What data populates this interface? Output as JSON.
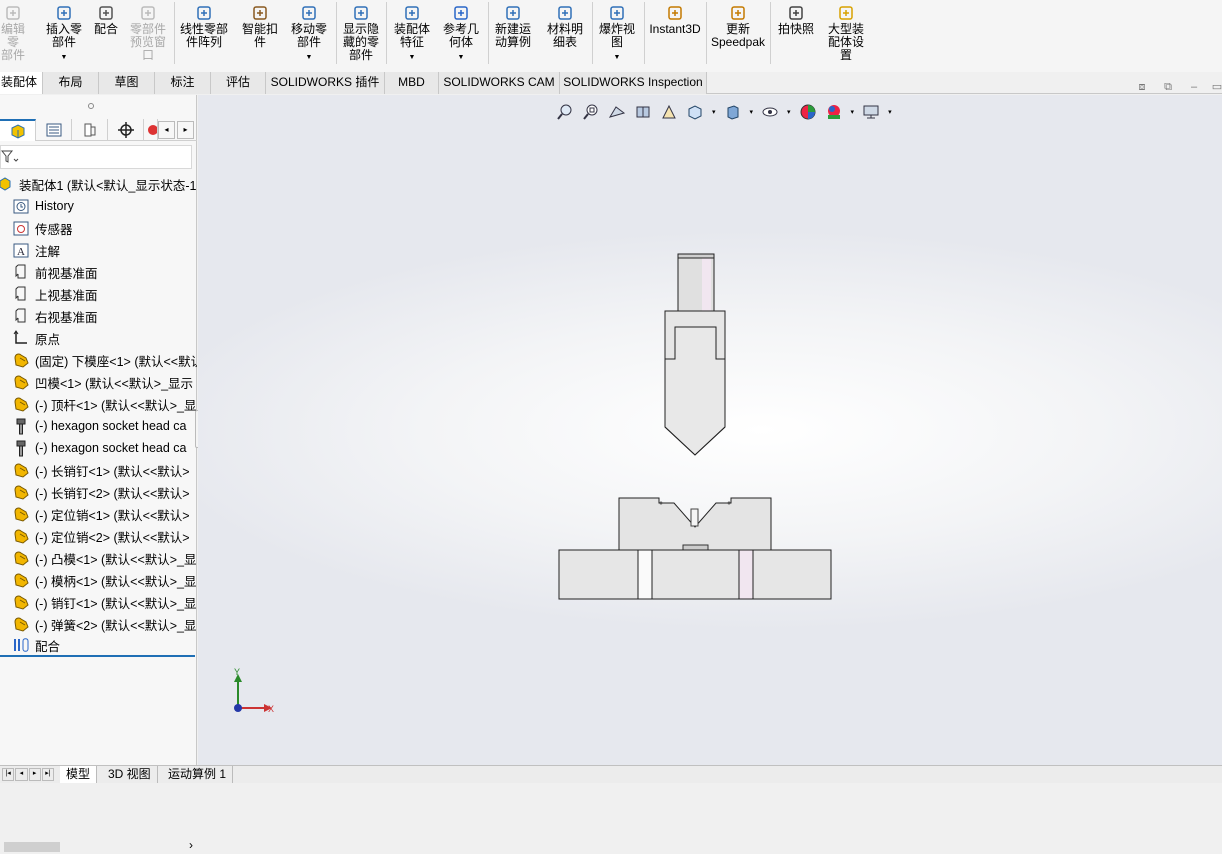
{
  "ribbon": {
    "buttons": [
      {
        "label": "编辑零\n部件",
        "disabled": true,
        "icon": "edit-part-icon"
      },
      {
        "label": "插入零\n部件",
        "disabled": false,
        "icon": "insert-component-icon"
      },
      {
        "label": "配合",
        "disabled": false,
        "icon": "mate-icon"
      },
      {
        "label": "零部件\n预览窗\n口",
        "disabled": true,
        "icon": "component-preview-icon"
      },
      {
        "label": "线性零部\n件阵列",
        "disabled": false,
        "icon": "linear-pattern-icon"
      },
      {
        "label": "智能扣\n件",
        "disabled": false,
        "icon": "smart-fasteners-icon"
      },
      {
        "label": "移动零\n部件",
        "disabled": false,
        "icon": "move-component-icon"
      },
      {
        "label": "显示隐\n藏的零\n部件",
        "disabled": false,
        "icon": "show-hidden-icon"
      },
      {
        "label": "装配体\n特征",
        "disabled": false,
        "icon": "assembly-features-icon"
      },
      {
        "label": "参考几\n何体",
        "disabled": false,
        "icon": "reference-geometry-icon"
      },
      {
        "label": "新建运\n动算例",
        "disabled": false,
        "icon": "new-motion-study-icon"
      },
      {
        "label": "材料明\n细表",
        "disabled": false,
        "icon": "bom-icon"
      },
      {
        "label": "爆炸视\n图",
        "disabled": false,
        "icon": "exploded-view-icon"
      },
      {
        "label": "Instant3D",
        "disabled": false,
        "icon": "instant3d-icon"
      },
      {
        "label": "更新\nSpeedpak",
        "disabled": false,
        "icon": "speedpak-icon"
      },
      {
        "label": "拍快照",
        "disabled": false,
        "icon": "snapshot-icon"
      },
      {
        "label": "大型装\n配体设\n置",
        "disabled": false,
        "icon": "large-assembly-icon"
      }
    ]
  },
  "tabs": [
    "装配体",
    "布局",
    "草图",
    "标注",
    "评估",
    "SOLIDWORKS 插件",
    "MBD",
    "SOLIDWORKS CAM",
    "SOLIDWORKS Inspection"
  ],
  "tree": {
    "root": "装配体1 (默认<默认_显示状态-1>",
    "items": [
      {
        "label": "History",
        "icon": "history-icon"
      },
      {
        "label": "传感器",
        "icon": "sensor-icon"
      },
      {
        "label": "注解",
        "icon": "annotation-icon"
      },
      {
        "label": "前视基准面",
        "icon": "plane-icon"
      },
      {
        "label": "上视基准面",
        "icon": "plane-icon"
      },
      {
        "label": "右视基准面",
        "icon": "plane-icon"
      },
      {
        "label": "原点",
        "icon": "origin-icon"
      },
      {
        "label": "(固定) 下模座<1> (默认<<默认",
        "icon": "part-icon"
      },
      {
        "label": "凹模<1> (默认<<默认>_显示",
        "icon": "part-icon"
      },
      {
        "label": "(-) 顶杆<1> (默认<<默认>_显",
        "icon": "part-icon"
      },
      {
        "label": "(-) hexagon socket head ca",
        "icon": "screw-icon"
      },
      {
        "label": "(-) hexagon socket head ca",
        "icon": "screw-icon"
      },
      {
        "label": "(-) 长销钉<1> (默认<<默认>",
        "icon": "part-icon"
      },
      {
        "label": "(-) 长销钉<2> (默认<<默认>",
        "icon": "part-icon"
      },
      {
        "label": "(-) 定位销<1> (默认<<默认>",
        "icon": "part-icon"
      },
      {
        "label": "(-) 定位销<2> (默认<<默认>",
        "icon": "part-icon"
      },
      {
        "label": "(-) 凸模<1> (默认<<默认>_显",
        "icon": "part-icon"
      },
      {
        "label": "(-) 模柄<1> (默认<<默认>_显",
        "icon": "part-icon"
      },
      {
        "label": "(-) 销钉<1> (默认<<默认>_显",
        "icon": "part-icon"
      },
      {
        "label": "(-) 弹簧<2> (默认<<默认>_显",
        "icon": "part-icon"
      },
      {
        "label": "配合",
        "icon": "mates-folder-icon"
      }
    ]
  },
  "triad": {
    "x": "X",
    "y": "Y"
  },
  "bottom_tabs": [
    "模型",
    "3D 视图",
    "运动算例 1"
  ],
  "colors": {
    "accent": "#1f6fb5",
    "part_yellow": "#f2b600",
    "model_fill": "#e3e3e3"
  }
}
